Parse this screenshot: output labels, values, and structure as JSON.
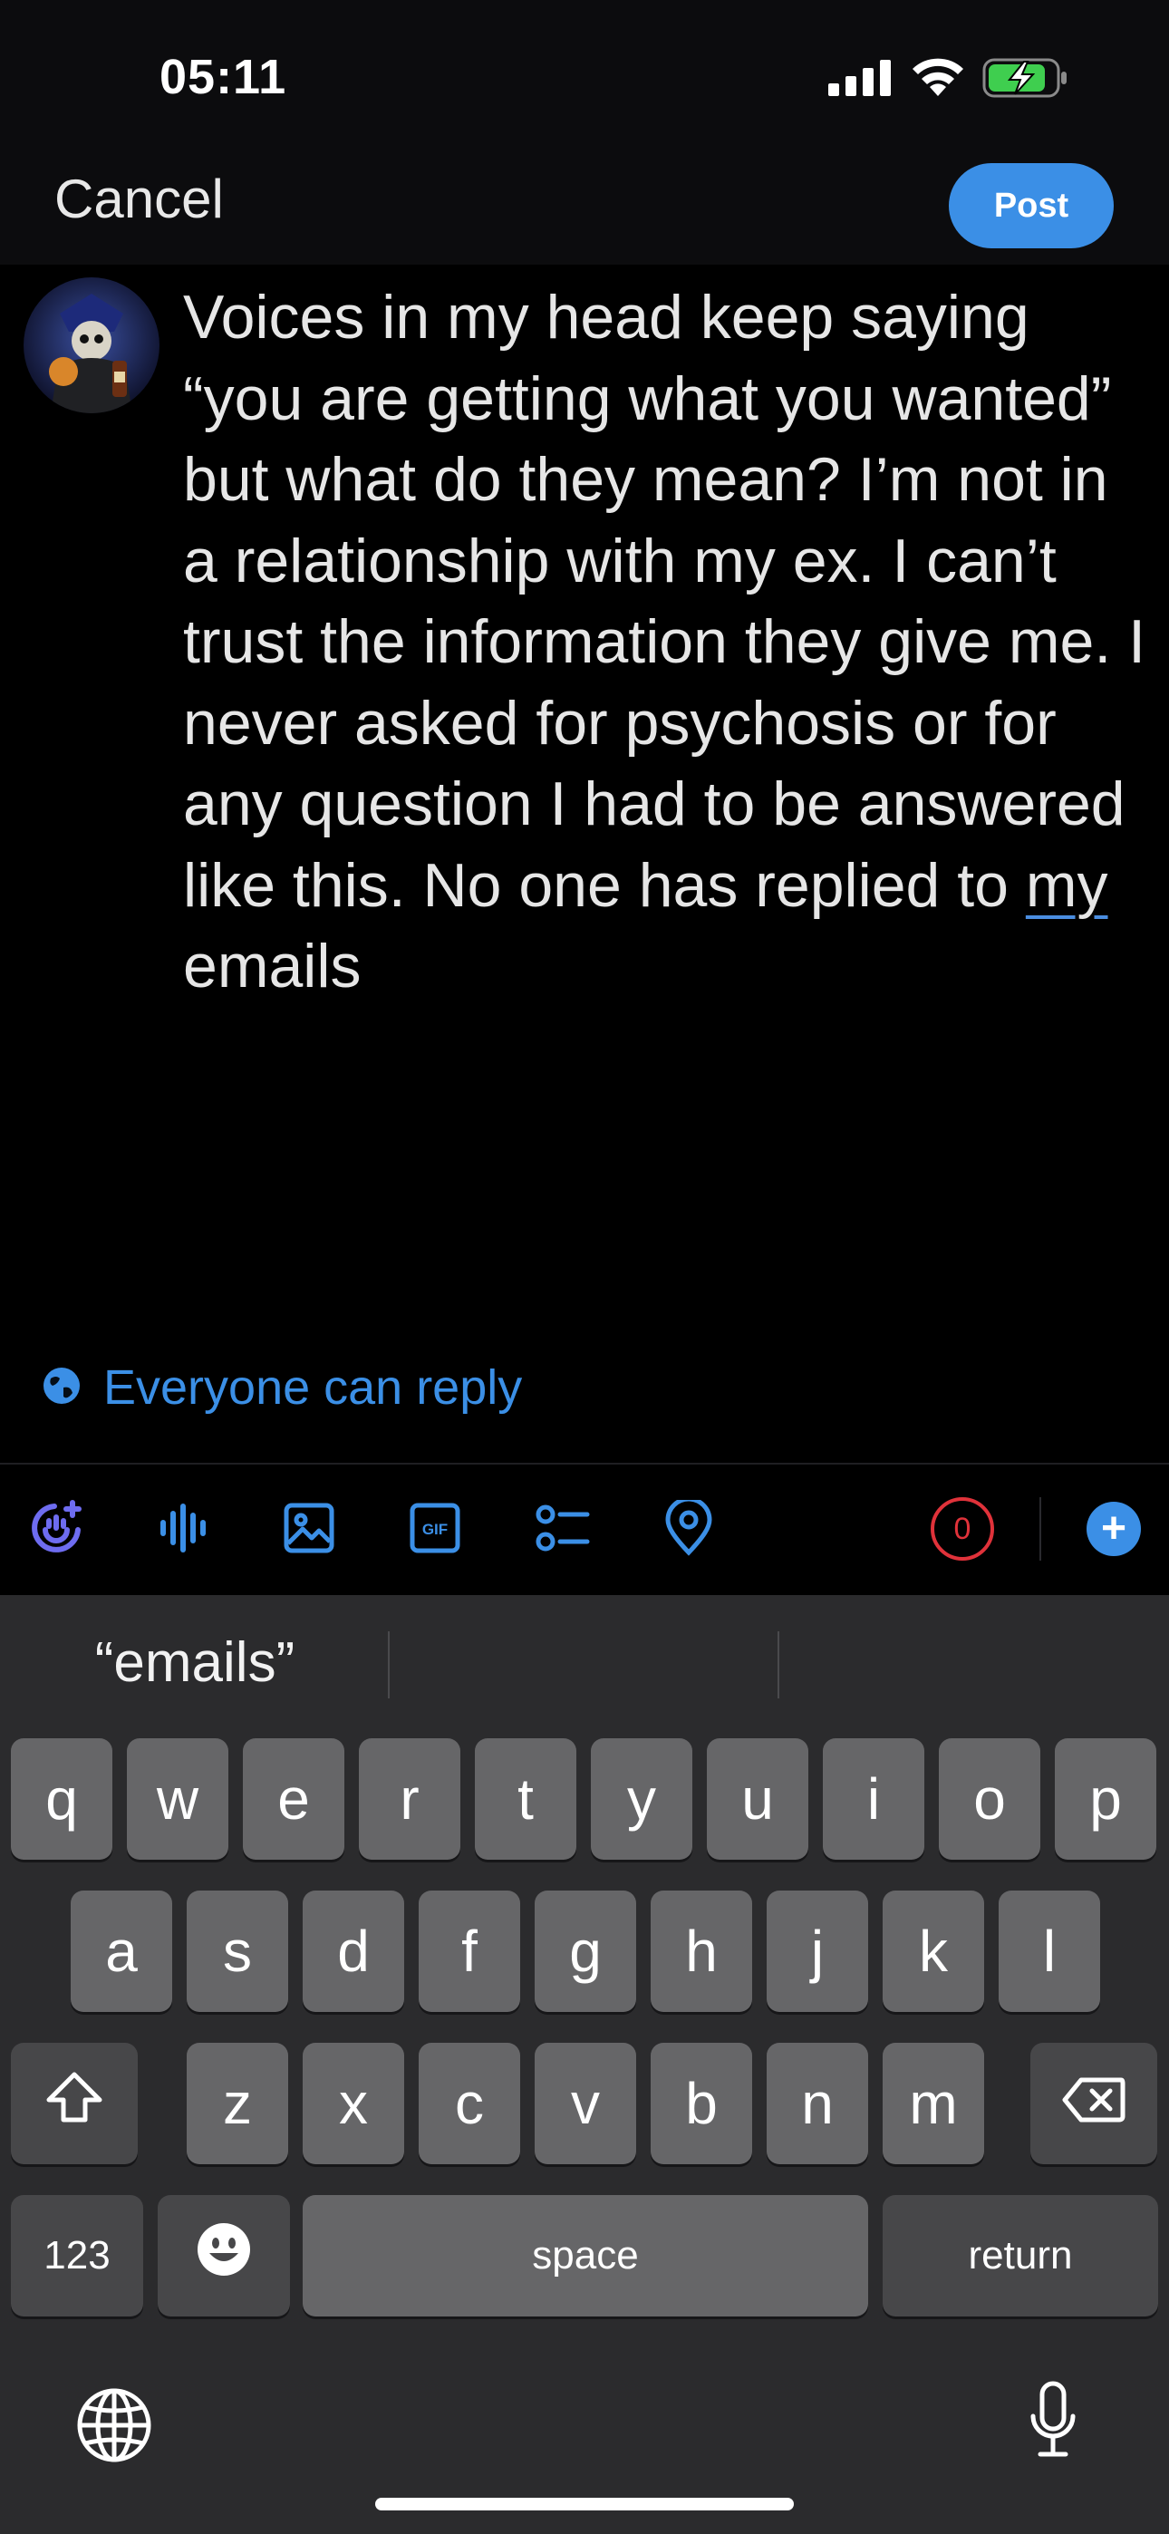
{
  "status_bar": {
    "time": "05:11"
  },
  "nav": {
    "cancel_label": "Cancel",
    "post_label": "Post"
  },
  "compose": {
    "text_before": "Voices in my head keep saying “you are getting what you wanted” but what do they mean? I’m not in a relationship with my ex. I can’t trust the information they give me. I never asked for psychosis or for any question I had to be answered like this. No one has replied to ",
    "underlined_word": "my",
    "text_after": " emails"
  },
  "reply_setting": {
    "label": "Everyone can reply",
    "icon": "globe-icon"
  },
  "toolbar": {
    "icons": [
      "grok-add-icon",
      "audio-waveform-icon",
      "image-icon",
      "gif-icon",
      "poll-icon",
      "location-pin-icon"
    ],
    "char_counter": "0",
    "add_thread_label": "+"
  },
  "keyboard": {
    "suggestion": "“emails”",
    "row1": [
      "q",
      "w",
      "e",
      "r",
      "t",
      "y",
      "u",
      "i",
      "o",
      "p"
    ],
    "row2": [
      "a",
      "s",
      "d",
      "f",
      "g",
      "h",
      "j",
      "k",
      "l"
    ],
    "row3": [
      "z",
      "x",
      "c",
      "v",
      "b",
      "n",
      "m"
    ],
    "numbers_label": "123",
    "space_label": "space",
    "return_label": "return"
  },
  "colors": {
    "accent": "#3b8fe6",
    "counter": "#e0323a",
    "key": "#666668",
    "keyboard_bg": "#2b2b2d"
  }
}
